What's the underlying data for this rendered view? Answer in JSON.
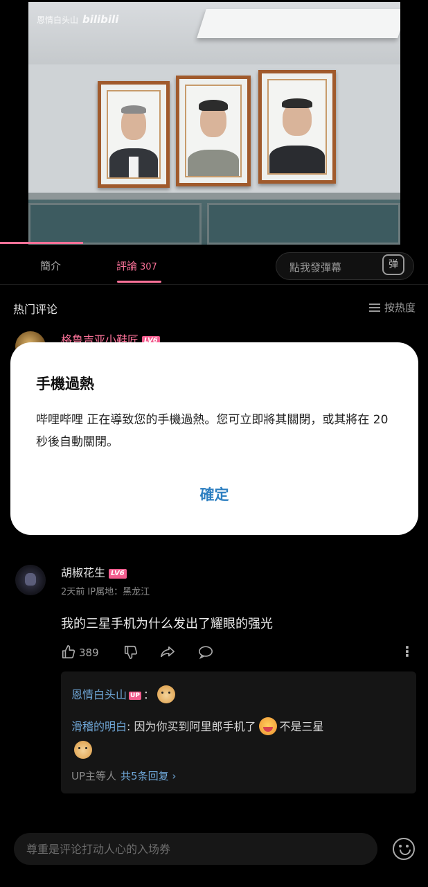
{
  "video": {
    "watermark_text": "恩情白头山",
    "watermark_logo": "bilibili"
  },
  "tabs": {
    "intro_label": "簡介",
    "comments_label": "評論",
    "comments_count": "307",
    "danmaku_placeholder": "點我發彈幕",
    "danmaku_icon_glyph": "弹"
  },
  "hot": {
    "title": "热门评论",
    "sort_label": "按热度"
  },
  "partial_comment": {
    "user": "格鲁吉亚小鞋匠",
    "level": "LV6"
  },
  "dialog": {
    "title": "手機過熱",
    "body": "哔哩哔哩 正在導致您的手機過熱。您可立即將其關閉，或其將在 20 秒後自動關閉。",
    "ok_label": "確定"
  },
  "comment": {
    "user": "胡椒花生",
    "level": "LV6",
    "meta": "2天前  IP属地：黑龙江",
    "text": "我的三星手机为什么发出了耀眼的强光",
    "likes": "389"
  },
  "replies": {
    "r1_user": "恩情白头山",
    "r1_badge": "UP",
    "r1_sep": "：",
    "r2_user": "滑稽的明白",
    "r2_sep": ": ",
    "r2_text": "因为你买到阿里郎手机了",
    "r2_text2": "不是三星",
    "footer_prefix": "UP主等人",
    "footer_link": "共5条回复 ›"
  },
  "input": {
    "placeholder": "尊重是评论打动人心的入场券"
  },
  "colors": {
    "accent_pink": "#fb7299",
    "link_blue": "#6fa7d8",
    "dialog_button_blue": "#2d7fc1"
  }
}
